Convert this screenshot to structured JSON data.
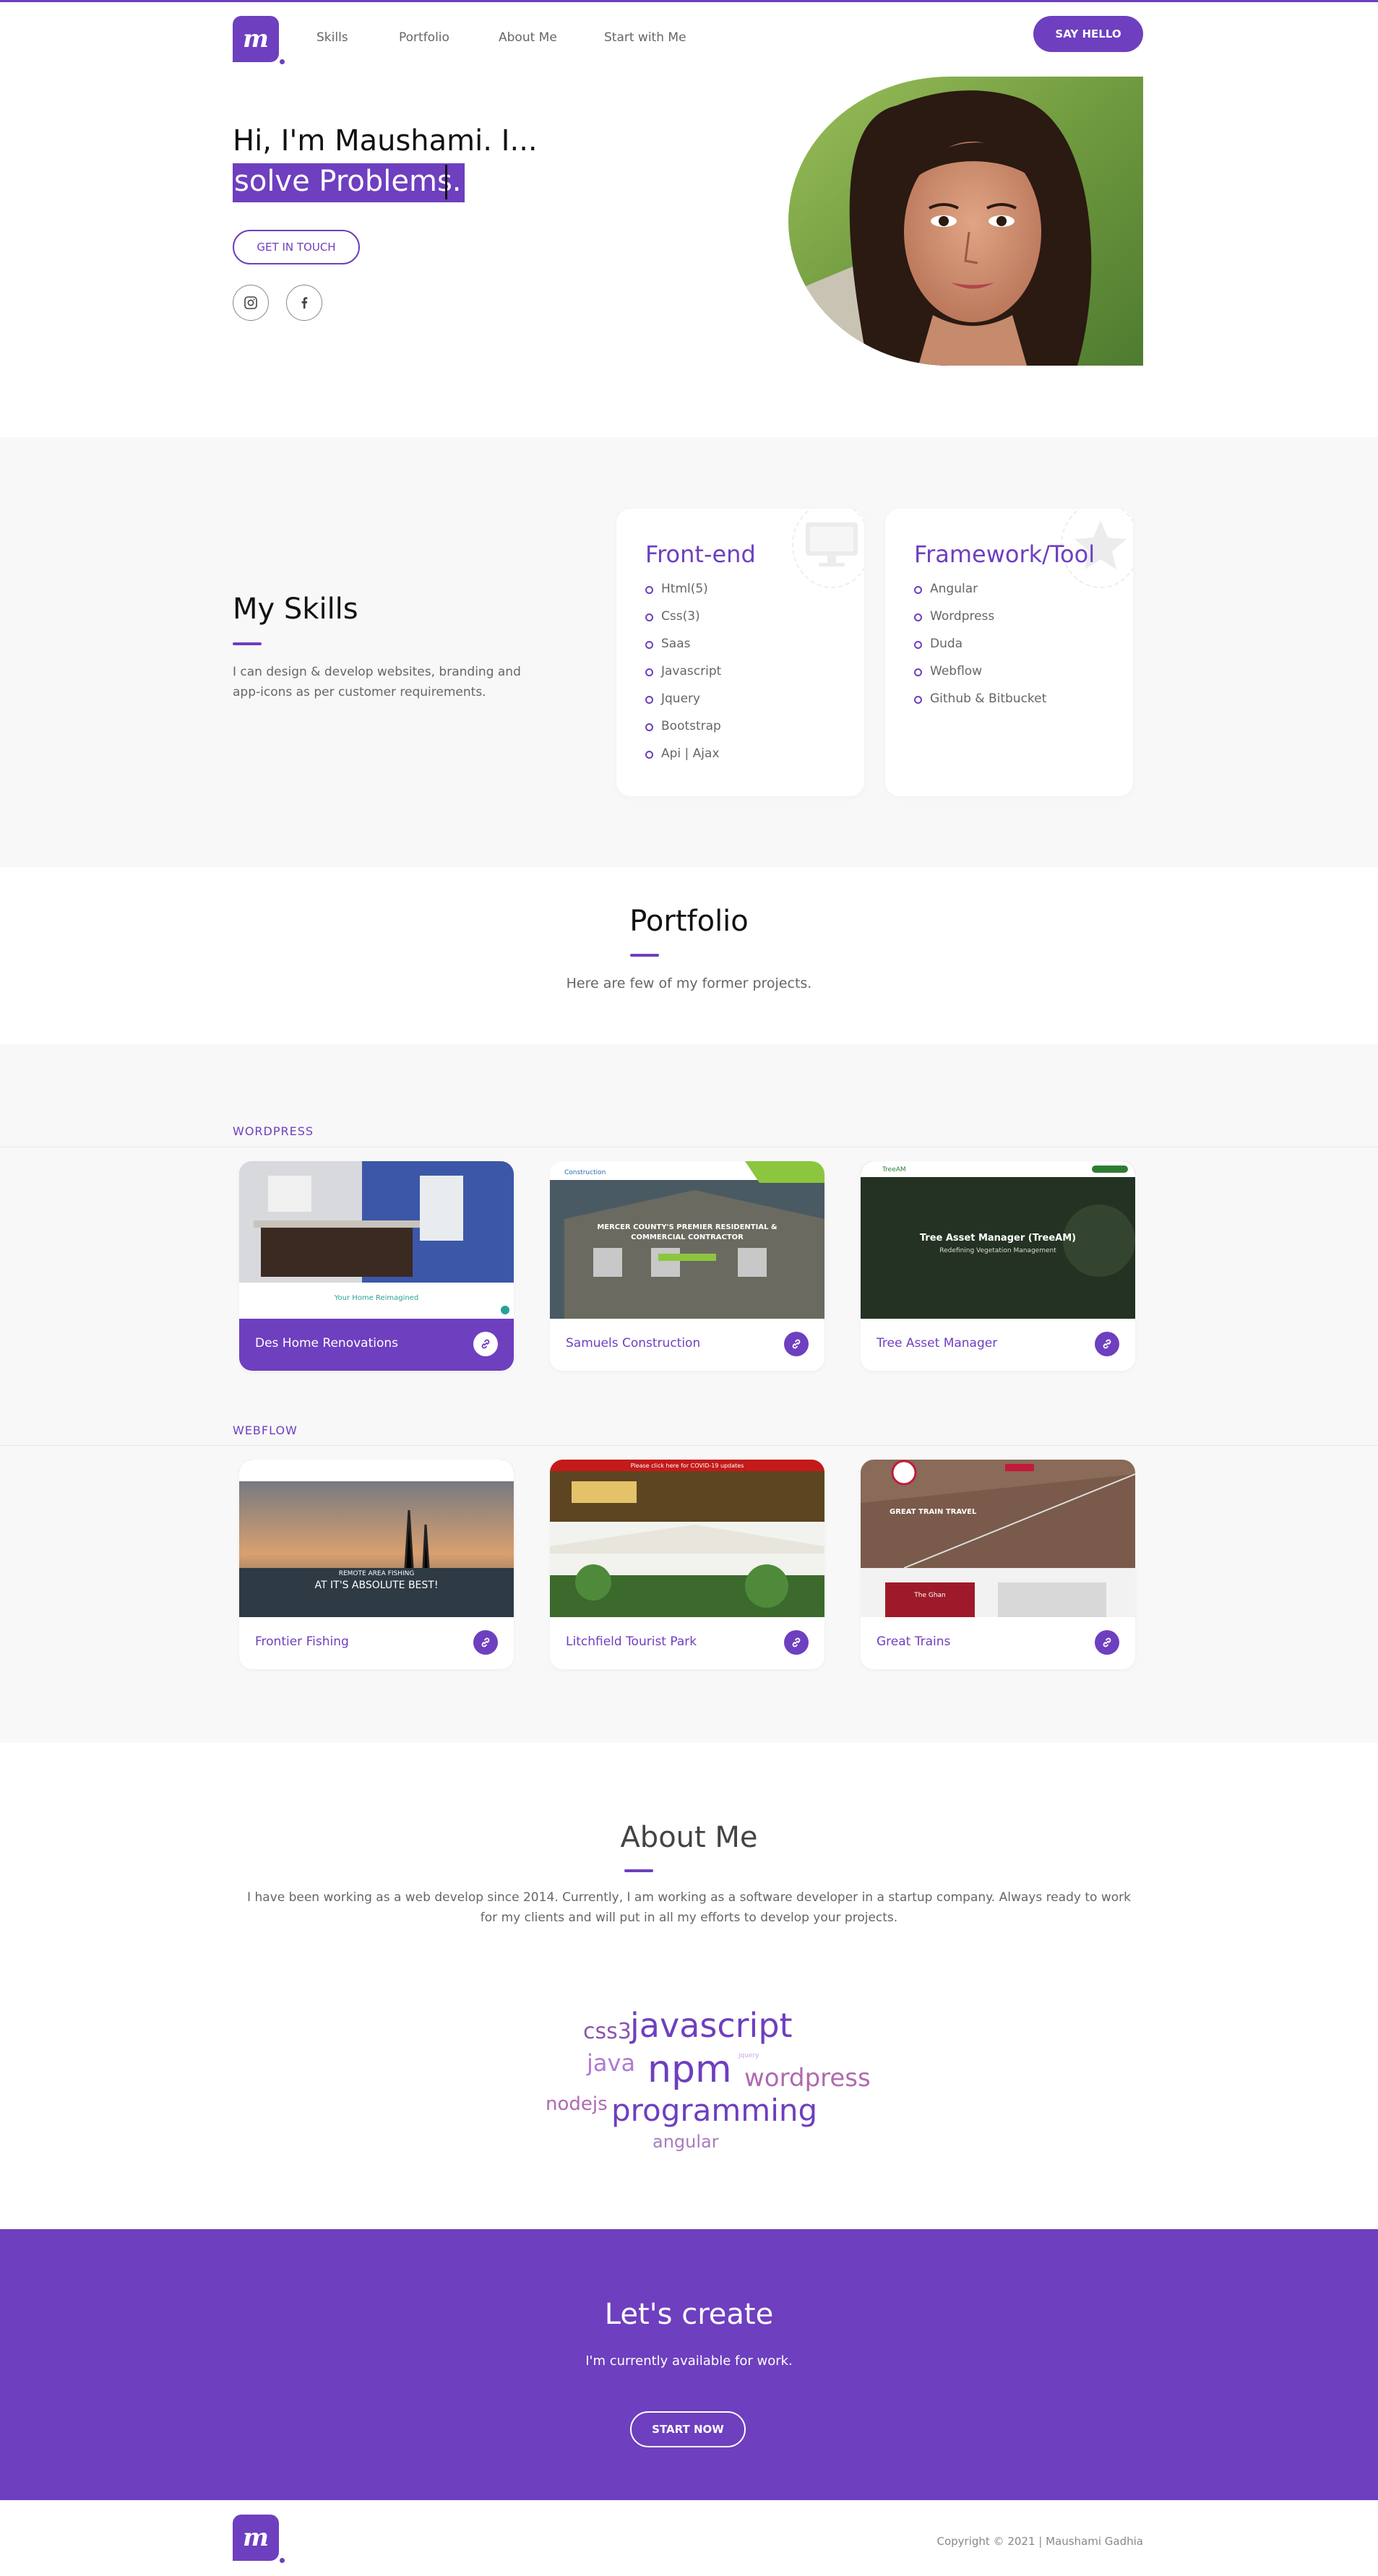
{
  "brand": {
    "logo_letter": "m",
    "accent": "#6e3fbf"
  },
  "nav": {
    "items": [
      "Skills",
      "Portfolio",
      "About Me",
      "Start with Me"
    ],
    "cta": "SAY HELLO"
  },
  "hero": {
    "line1": "Hi, I'm Maushami. I...",
    "line2": "solve Problems.",
    "button": "GET IN TOUCH",
    "social": [
      "instagram-icon",
      "facebook-icon"
    ]
  },
  "skills": {
    "title": "My Skills",
    "description": "I can design & develop websites, branding and app-icons as per customer requirements.",
    "cards": [
      {
        "title": "Front-end",
        "items": [
          "Html(5)",
          "Css(3)",
          "Saas",
          "Javascript",
          "Jquery",
          "Bootstrap",
          "Api | Ajax"
        ]
      },
      {
        "title": "Framework/Tool",
        "items": [
          "Angular",
          "Wordpress",
          "Duda",
          "Webflow",
          "Github & Bitbucket"
        ]
      }
    ]
  },
  "portfolio": {
    "title": "Portfolio",
    "description": "Here are few of my former projects.",
    "wordpress_label": "WORDPRESS",
    "webflow_label": "WEBFLOW",
    "wordpress": [
      {
        "title": "Des Home Renovations",
        "thumb_caption": "Your Home Reimagined"
      },
      {
        "title": "Samuels Construction",
        "thumb_caption": "MERCER COUNTY'S PREMIER RESIDENTIAL & COMMERCIAL CONTRACTOR",
        "thumb_logo": "Construction"
      },
      {
        "title": "Tree Asset Manager",
        "thumb_caption": "Tree Asset Manager (TreeAM)",
        "thumb_sub": "Redefining Vegetation Management",
        "thumb_logo": "TreeAM"
      }
    ],
    "webflow": [
      {
        "title": "Frontier Fishing",
        "thumb_caption": "REMOTE AREA FISHING",
        "thumb_sub": "AT IT'S ABSOLUTE BEST!"
      },
      {
        "title": "Litchfield Tourist Park",
        "thumb_caption": "Please click here for COVID-19 updates"
      },
      {
        "title": "Great Trains",
        "thumb_caption": "GREAT TRAIN TRAVEL",
        "thumb_sub": "The Ghan"
      }
    ]
  },
  "about": {
    "title": "About Me",
    "description": "I have been working as a web develop since 2014. Currently, I am working as a software developer in a startup company. Always ready to work for my clients and will put in all my efforts to develop your projects.",
    "cloud": [
      "css3",
      "javascript",
      "java",
      "npm",
      "jquery",
      "wordpress",
      "nodejs",
      "programming",
      "angular"
    ]
  },
  "cta": {
    "title": "Let's create",
    "text": "I'm currently available for work.",
    "button": "START NOW"
  },
  "footer": {
    "copyright": "Copyright © 2021 | Maushami Gadhia"
  }
}
